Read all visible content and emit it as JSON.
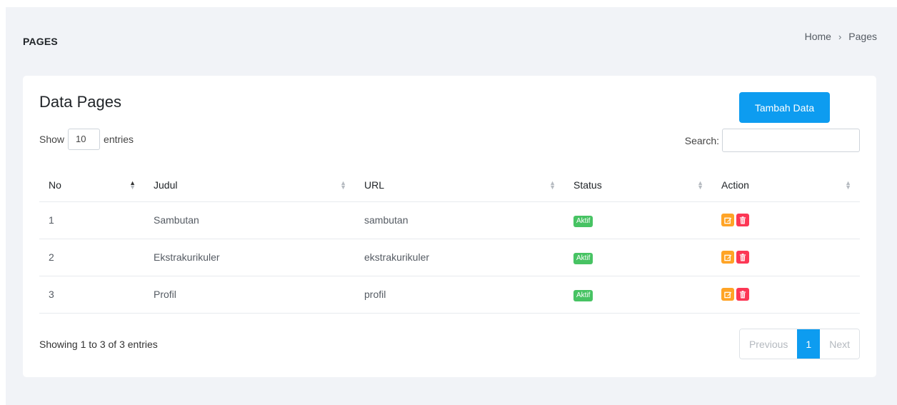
{
  "header": {
    "title": "PAGES",
    "breadcrumb": {
      "home": "Home",
      "separator": "›",
      "current": "Pages"
    }
  },
  "card": {
    "title": "Data Pages",
    "add_button": "Tambah Data",
    "length": {
      "show": "Show",
      "value": "10",
      "entries": "entries"
    },
    "search": {
      "label": "Search:",
      "value": ""
    },
    "columns": [
      "No",
      "Judul",
      "URL",
      "Status",
      "Action"
    ],
    "rows": [
      {
        "no": "1",
        "judul": "Sambutan",
        "url": "sambutan",
        "status": "Aktif"
      },
      {
        "no": "2",
        "judul": "Ekstrakurikuler",
        "url": "ekstrakurikuler",
        "status": "Aktif"
      },
      {
        "no": "3",
        "judul": "Profil",
        "url": "profil",
        "status": "Aktif"
      }
    ],
    "info": "Showing 1 to 3 of 3 entries",
    "pagination": {
      "previous": "Previous",
      "current": "1",
      "next": "Next"
    }
  },
  "colors": {
    "primary": "#0d9cf0",
    "success": "#47c363",
    "warning": "#ffa426",
    "danger": "#fc3755"
  },
  "icons": {
    "edit": "edit-icon",
    "delete": "trash-icon",
    "sort": "sort-icon"
  }
}
